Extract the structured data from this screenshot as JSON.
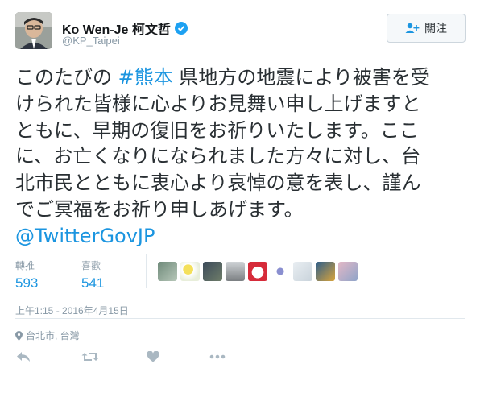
{
  "user": {
    "name": "Ko Wen-Je 柯文哲",
    "handle": "@KP_Taipei",
    "verified_icon": "verified-badge-icon"
  },
  "follow_button": {
    "label": "關注",
    "icon": "follow-person-plus-icon"
  },
  "tweet": {
    "lines": [
      {
        "before": "このたびの ",
        "link": "#熊本",
        "after": " 県地方の地震により被害を受"
      },
      {
        "before": "けられた皆様に心よりお見舞い申し上げますと",
        "link": "",
        "after": ""
      },
      {
        "before": "ともに、早期の復旧をお祈りいたします。ここ",
        "link": "",
        "after": ""
      },
      {
        "before": "に、お亡くなりになられました方々に対し、台",
        "link": "",
        "after": ""
      },
      {
        "before": "北市民とともに衷心より哀悼の意を表し、謹ん",
        "link": "",
        "after": ""
      },
      {
        "before": "でご冥福をお祈り申しあげます。",
        "link": "",
        "after": ""
      },
      {
        "before": "",
        "link": "@TwitterGovJP",
        "after": ""
      }
    ]
  },
  "stats": {
    "retweets_label": "轉推",
    "retweets_value": "593",
    "likes_label": "喜歡",
    "likes_value": "541"
  },
  "likers": [
    "avatar-1",
    "avatar-2",
    "avatar-3",
    "avatar-4",
    "avatar-5",
    "avatar-6",
    "avatar-7",
    "avatar-8",
    "avatar-9"
  ],
  "timestamp": "上午1:15 - 2016年4月15日",
  "location": "台北市, 台灣",
  "actions": [
    "reply-icon",
    "retweet-icon",
    "like-heart-icon",
    "more-dots-icon"
  ],
  "colors": {
    "link": "#1b95e0",
    "verified": "#1da1f2",
    "muted": "#8899a6"
  }
}
